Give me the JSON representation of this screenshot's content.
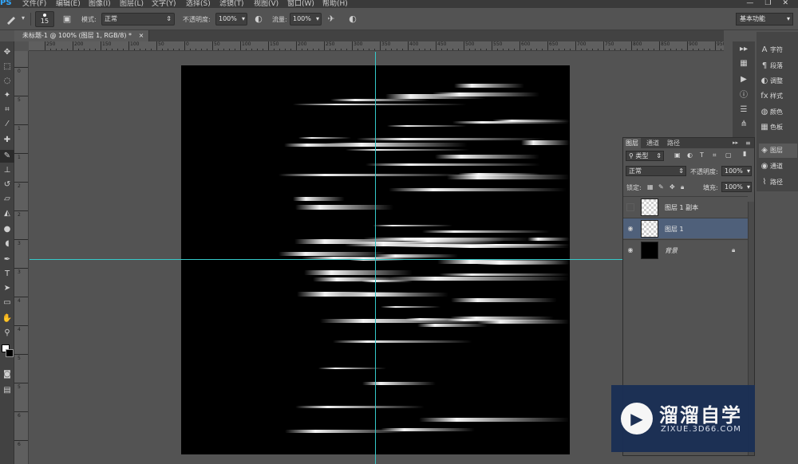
{
  "app": {
    "logo": "PS"
  },
  "menu": [
    "文件(F)",
    "编辑(E)",
    "图像(I)",
    "图层(L)",
    "文字(Y)",
    "选择(S)",
    "滤镜(T)",
    "视图(V)",
    "窗口(W)",
    "帮助(H)"
  ],
  "window_controls": {
    "minimize": "—",
    "restore": "❐",
    "close": "✕"
  },
  "options": {
    "brush_size": "15",
    "mode_label": "模式:",
    "mode_value": "正常",
    "opacity_label": "不透明度:",
    "opacity_value": "100%",
    "flow_label": "流量:",
    "flow_value": "100%",
    "workspace": "基本功能"
  },
  "document": {
    "tab_title": "未标题-1 @ 100% (图层 1, RGB/8) *",
    "tab_close": "×"
  },
  "ruler": {
    "h_labels": [
      "250",
      "200",
      "150",
      "100",
      "50",
      "0",
      "50",
      "100",
      "150",
      "200",
      "250",
      "300",
      "350",
      "400",
      "450",
      "500",
      "550",
      "600",
      "650",
      "700",
      "750",
      "800",
      "850",
      "900",
      "950"
    ],
    "v_labels": [
      "0",
      "5",
      "1",
      "1",
      "2",
      "2",
      "3",
      "3",
      "4",
      "4",
      "5",
      "5",
      "6",
      "6",
      "7"
    ]
  },
  "tools": [
    "move-icon",
    "marquee-icon",
    "lasso-icon",
    "magic-wand-icon",
    "crop-icon",
    "eyedropper-icon",
    "healing-icon",
    "brush-icon",
    "stamp-icon",
    "history-brush-icon",
    "eraser-icon",
    "bucket-icon",
    "blur-icon",
    "dodge-icon",
    "pen-icon",
    "type-icon",
    "path-select-icon",
    "shape-icon",
    "hand-icon",
    "zoom-icon"
  ],
  "right_panel": {
    "items": [
      {
        "icon": "character-icon",
        "label": "字符"
      },
      {
        "icon": "paragraph-icon",
        "label": "段落"
      },
      {
        "icon": "adjustments-icon",
        "label": "调整"
      },
      {
        "icon": "styles-icon",
        "label": "样式"
      },
      {
        "icon": "color-icon",
        "label": "颜色"
      },
      {
        "icon": "swatches-icon",
        "label": "色板"
      },
      {
        "icon": "layers-icon",
        "label": "图层"
      },
      {
        "icon": "channels-icon",
        "label": "通道"
      },
      {
        "icon": "paths-icon",
        "label": "路径"
      }
    ]
  },
  "layers_panel": {
    "tabs": [
      "图层",
      "通道",
      "路径"
    ],
    "filter_label": "类型",
    "blend_mode": "正常",
    "opacity_label": "不透明度:",
    "opacity_value": "100%",
    "lock_label": "锁定:",
    "fill_label": "填充:",
    "fill_value": "100%",
    "layers": [
      {
        "name": "图层 1 副本",
        "visible": false,
        "selected": false,
        "thumb": "transparent"
      },
      {
        "name": "图层 1",
        "visible": true,
        "selected": true,
        "thumb": "transparent"
      },
      {
        "name": "背景",
        "visible": true,
        "selected": false,
        "thumb": "black",
        "locked": true
      }
    ]
  },
  "watermark": {
    "title": "溜溜自学",
    "url": "ZIXUE.3D66.COM"
  },
  "colors": {
    "guide": "#35c9c9",
    "canvas": "#000000",
    "workspace_bg": "#535353",
    "selected_layer": "#4f607a",
    "watermark_bg": "#1a2f55"
  }
}
